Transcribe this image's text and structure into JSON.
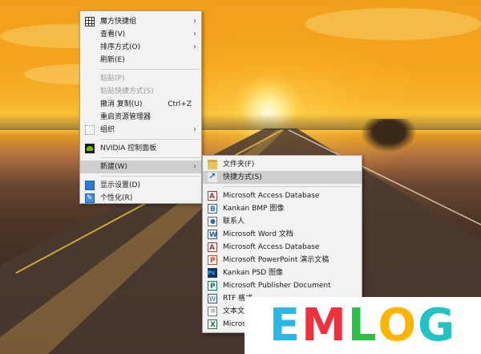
{
  "main_menu": {
    "items": [
      {
        "label": "魔方快捷组",
        "icon": "grid-icon",
        "submenu": true,
        "disabled": false
      },
      {
        "label": "查看(V)",
        "submenu": true,
        "disabled": false
      },
      {
        "label": "排序方式(O)",
        "submenu": true,
        "disabled": false
      },
      {
        "label": "刷新(E)",
        "submenu": false,
        "disabled": false
      },
      {
        "label": "粘贴(P)",
        "disabled": true
      },
      {
        "label": "粘贴快捷方式(S)",
        "disabled": true
      },
      {
        "label": "撤消 复制(U)",
        "shortcut": "Ctrl+Z",
        "disabled": false
      },
      {
        "label": "重启资源管理器",
        "disabled": false
      },
      {
        "label": "组织",
        "icon": "organize-icon",
        "submenu": true,
        "disabled": false
      },
      {
        "label": "NVIDIA 控制面板",
        "icon": "nvidia-icon",
        "disabled": false
      },
      {
        "label": "新建(W)",
        "submenu": true,
        "highlighted": true
      },
      {
        "label": "显示设置(D)",
        "icon": "display-icon"
      },
      {
        "label": "个性化(R)",
        "icon": "personalize-icon"
      }
    ]
  },
  "new_submenu": {
    "items": [
      {
        "label": "文件夹(F)",
        "icon": "folder-icon"
      },
      {
        "label": "快捷方式(S)",
        "icon": "shortcut-icon",
        "highlighted": true
      },
      {
        "label": "Microsoft Access Database",
        "icon": "access-icon"
      },
      {
        "label": "Kankan BMP 图像",
        "icon": "bmp-icon"
      },
      {
        "label": "联系人",
        "icon": "contact-icon"
      },
      {
        "label": "Microsoft Word 文档",
        "icon": "word-icon"
      },
      {
        "label": "Microsoft Access Database",
        "icon": "access-icon"
      },
      {
        "label": "Microsoft PowerPoint 演示文稿",
        "icon": "powerpoint-icon"
      },
      {
        "label": "Kankan PSD 图像",
        "icon": "psd-icon"
      },
      {
        "label": "Microsoft Publisher Document",
        "icon": "publisher-icon"
      },
      {
        "label": "RTF 格式",
        "icon": "rtf-icon"
      },
      {
        "label": "文本文档",
        "icon": "text-icon"
      },
      {
        "label": "Microso",
        "icon": "excel-icon"
      }
    ]
  },
  "watermark": {
    "letters": [
      "E",
      "M",
      "L",
      "O",
      "G"
    ],
    "colors": [
      "#29b8e8",
      "#f0303a",
      "#2dbf4a",
      "#ffb400",
      "#21c3c3"
    ]
  },
  "colors": {
    "menu_bg": "#f2f2f2",
    "highlight": "#cfcfcf",
    "disabled_text": "#9a9a9a"
  }
}
